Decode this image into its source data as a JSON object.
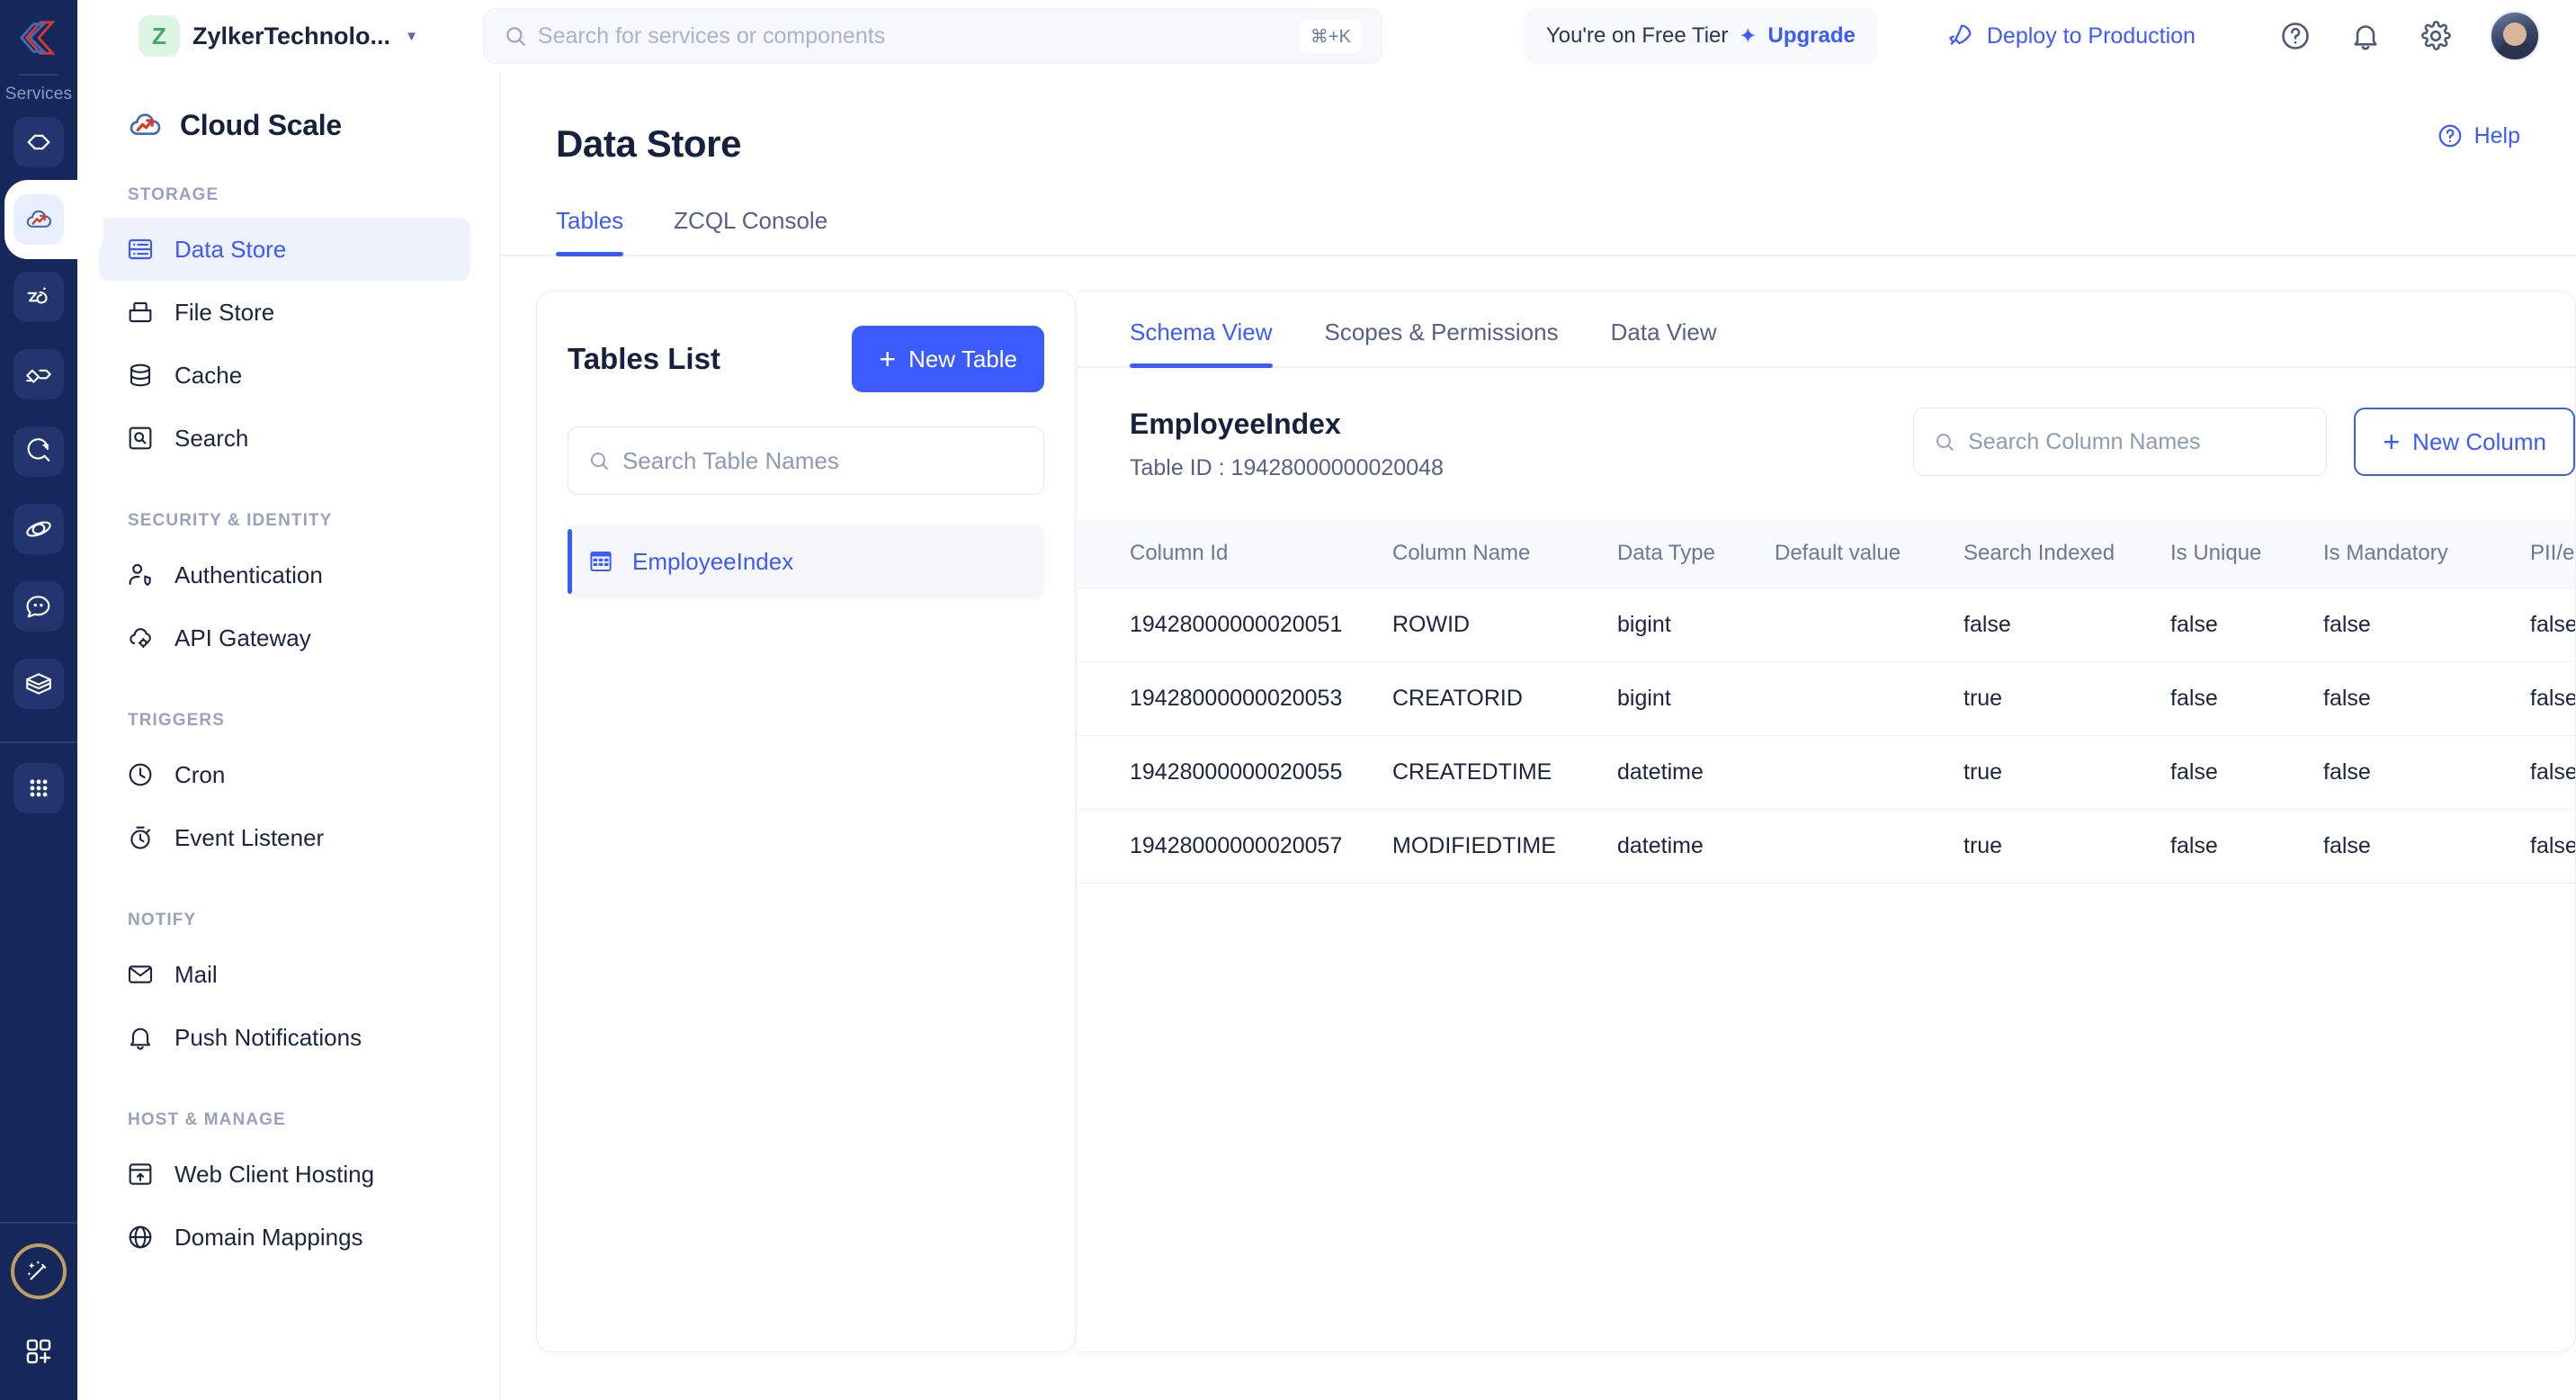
{
  "brand": {
    "logo_icon": "catalyst-logo-icon",
    "rail_section_label": "Services"
  },
  "rail": {
    "items": [
      {
        "icon": "code-brackets-icon",
        "name": "serverless",
        "active": false
      },
      {
        "icon": "cloud-scale-icon",
        "name": "cloud-scale",
        "active": true
      },
      {
        "icon": "zia-icon",
        "name": "zia",
        "active": false
      },
      {
        "icon": "devops-icon",
        "name": "devops",
        "active": false
      },
      {
        "icon": "quickml-icon",
        "name": "quickml",
        "active": false
      },
      {
        "icon": "orbit-icon",
        "name": "orbit",
        "active": false
      },
      {
        "icon": "chat-bot-icon",
        "name": "chat-bot",
        "active": false
      },
      {
        "icon": "box-layers-icon",
        "name": "packages",
        "active": false
      },
      {
        "icon": "grid-apps-icon",
        "name": "all-apps",
        "active": false
      },
      {
        "icon": "magic-wand-icon",
        "name": "magic-wand",
        "active": false
      },
      {
        "icon": "add-app-icon",
        "name": "add-app",
        "active": false
      }
    ]
  },
  "topbar": {
    "org_initial": "Z",
    "org_name": "ZylkerTechnolo...",
    "caret_icon": "chevron-down-icon",
    "search": {
      "placeholder": "Search for services or components",
      "value": "",
      "shortcut": "⌘+K",
      "icon": "search-icon"
    },
    "tier": {
      "text": "You're on Free Tier",
      "upgrade_label": "Upgrade",
      "spark_icon": "sparkle-icon"
    },
    "deploy": {
      "label": "Deploy to Production",
      "icon": "rocket-icon"
    },
    "icons": [
      {
        "name": "help-circle-icon"
      },
      {
        "name": "bell-icon"
      },
      {
        "name": "gear-icon"
      }
    ],
    "avatar_name": "user-avatar"
  },
  "sidebar": {
    "product_title": "Cloud Scale",
    "product_icon": "cloud-scale-icon",
    "groups": [
      {
        "label": "STORAGE",
        "items": [
          {
            "label": "Data Store",
            "icon": "data-store-icon",
            "active": true
          },
          {
            "label": "File Store",
            "icon": "file-store-icon",
            "active": false
          },
          {
            "label": "Cache",
            "icon": "database-icon",
            "active": false
          },
          {
            "label": "Search",
            "icon": "search-box-icon",
            "active": false
          }
        ]
      },
      {
        "label": "SECURITY & IDENTITY",
        "items": [
          {
            "label": "Authentication",
            "icon": "user-shield-icon",
            "active": false
          },
          {
            "label": "API Gateway",
            "icon": "cloud-gear-icon",
            "active": false
          }
        ]
      },
      {
        "label": "TRIGGERS",
        "items": [
          {
            "label": "Cron",
            "icon": "clock-icon",
            "active": false
          },
          {
            "label": "Event Listener",
            "icon": "stopwatch-icon",
            "active": false
          }
        ]
      },
      {
        "label": "NOTIFY",
        "items": [
          {
            "label": "Mail",
            "icon": "envelope-icon",
            "active": false
          },
          {
            "label": "Push Notifications",
            "icon": "bell-icon",
            "active": false
          }
        ]
      },
      {
        "label": "HOST & MANAGE",
        "items": [
          {
            "label": "Web Client Hosting",
            "icon": "window-upload-icon",
            "active": false
          },
          {
            "label": "Domain Mappings",
            "icon": "globe-icon",
            "active": false
          }
        ]
      }
    ]
  },
  "main": {
    "page_title": "Data Store",
    "help_label": "Help",
    "help_icon": "help-circle-icon",
    "tabs": [
      {
        "label": "Tables",
        "active": true
      },
      {
        "label": "ZCQL Console",
        "active": false
      }
    ]
  },
  "tables_panel": {
    "title": "Tables List",
    "new_table_label": "New Table",
    "new_table_plus": "+",
    "search": {
      "placeholder": "Search Table Names",
      "value": "",
      "icon": "search-icon"
    },
    "items": [
      {
        "label": "EmployeeIndex",
        "icon": "table-grid-icon",
        "active": true
      }
    ]
  },
  "schema_panel": {
    "tabs": [
      {
        "label": "Schema View",
        "active": true
      },
      {
        "label": "Scopes & Permissions",
        "active": false
      },
      {
        "label": "Data View",
        "active": false
      }
    ],
    "table_name": "EmployeeIndex",
    "table_id_label": "Table ID : 19428000000020048",
    "column_search": {
      "placeholder": "Search Column Names",
      "value": "",
      "icon": "search-icon"
    },
    "new_column_label": "New Column",
    "new_column_plus": "+",
    "columns": [
      "Column Id",
      "Column Name",
      "Data Type",
      "Default value",
      "Search Indexed",
      "Is Unique",
      "Is Mandatory",
      "PII/ePHI"
    ],
    "rows": [
      {
        "column_id": "19428000000020051",
        "column_name": "ROWID",
        "data_type": "bigint",
        "default_value": "",
        "search_indexed": "false",
        "is_unique": "false",
        "is_mandatory": "false",
        "pii": "false"
      },
      {
        "column_id": "19428000000020053",
        "column_name": "CREATORID",
        "data_type": "bigint",
        "default_value": "",
        "search_indexed": "true",
        "is_unique": "false",
        "is_mandatory": "false",
        "pii": "false"
      },
      {
        "column_id": "19428000000020055",
        "column_name": "CREATEDTIME",
        "data_type": "datetime",
        "default_value": "",
        "search_indexed": "true",
        "is_unique": "false",
        "is_mandatory": "false",
        "pii": "false"
      },
      {
        "column_id": "19428000000020057",
        "column_name": "MODIFIEDTIME",
        "data_type": "datetime",
        "default_value": "",
        "search_indexed": "true",
        "is_unique": "false",
        "is_mandatory": "false",
        "pii": "false"
      }
    ]
  },
  "colors": {
    "accent": "#3b5bfd",
    "rail_bg": "#16275c",
    "text_dark": "#16203f",
    "text_muted": "#6c779c",
    "gold": "#bf9f5d",
    "green": "#43a963"
  }
}
